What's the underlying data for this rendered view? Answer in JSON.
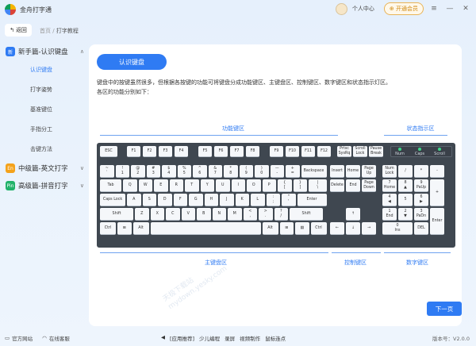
{
  "app": {
    "title": "金舟打字通",
    "user": "个人中心",
    "vip": "开通会员"
  },
  "nav": {
    "back": "返回",
    "crumb_home": "首页",
    "crumb_sep": "/",
    "crumb_current": "打字教程"
  },
  "sidebar": {
    "sections": [
      {
        "badge": "新",
        "badge_color": "#2f7bf3",
        "label": "新手篇-认识键盘",
        "chev": "∧"
      },
      {
        "badge": "En",
        "badge_color": "#f4a21b",
        "label": "中级篇-英文打字",
        "chev": "∨"
      },
      {
        "badge": "Pin",
        "badge_color": "#21b26a",
        "label": "高级篇-拼音打字",
        "chev": "∨"
      }
    ],
    "items": [
      "认识键盘",
      "打字姿势",
      "基准键位",
      "手指分工",
      "击键方法"
    ]
  },
  "content": {
    "heading": "认识键盘",
    "desc1": "键盘中的按键虽然很多，但根据各按键的功能可将键盘分成功能键区、主键盘区、控制键区、数字键区和状态指示灯区。",
    "desc2": "各区的功能分别如下：",
    "labels": {
      "function": "功能键区",
      "status": "状态指示区",
      "main": "主键盘区",
      "control": "控制键区",
      "numeric": "数字键区"
    },
    "next": "下一页"
  },
  "keyboard": {
    "fn_row": [
      "ESC",
      "F1",
      "F2",
      "F3",
      "F4",
      "F5",
      "F6",
      "F7",
      "F8",
      "F9",
      "F10",
      "F11",
      "F12"
    ],
    "sys_keys": [
      "Prtsc\nSysRq",
      "Scroll\nLock",
      "Pause\nBreak"
    ],
    "leds": [
      "Num",
      "Caps",
      "Scroll"
    ],
    "row1": [
      "~\n`",
      "!\n1",
      "@\n2",
      "#\n3",
      "$\n4",
      "%\n5",
      "^\n6",
      "&\n7",
      "*\n8",
      "(\n9",
      ")\n0",
      "—\n-",
      "+\n=",
      "Backspace"
    ],
    "row2": [
      "Tab",
      "Q",
      "W",
      "E",
      "R",
      "T",
      "Y",
      "U",
      "I",
      "O",
      "P",
      "{\n[",
      "}\n]",
      "|\n\\"
    ],
    "row3": [
      "Caps Lock",
      "A",
      "S",
      "D",
      "F",
      "G",
      "H",
      "J",
      "K",
      "L",
      ":\n;",
      "\"\n'",
      "Enter"
    ],
    "row4": [
      "Shift",
      "Z",
      "X",
      "C",
      "V",
      "B",
      "N",
      "M",
      "<\n,",
      ">\n.",
      "?\n/",
      "Shift"
    ],
    "row5": [
      "Ctrl",
      "⊞",
      "Alt",
      "",
      "Alt",
      "⊞",
      "▤",
      "Ctrl"
    ],
    "ctrl_top": [
      "Insert",
      "Home",
      "Page\nUp",
      "Delete",
      "End",
      "Page\nDown"
    ],
    "arrows": [
      "↑",
      "←",
      "↓",
      "→"
    ],
    "num": [
      "Num\nLock",
      "/",
      "*",
      "-",
      "7\nHome",
      "8\n▲",
      "9\nPaUp",
      "+",
      "4\n◀",
      "5",
      "6\n▶",
      "1\nEnd",
      "2\n▼",
      "3\nPaDn",
      "Enter",
      "0\nIns",
      "DEL"
    ]
  },
  "footer": {
    "site": "官方网站",
    "service": "在线客服",
    "rec": "[应用推荐]",
    "apps": [
      "少儿编程",
      "录屏",
      "视频制作",
      "鼠标连点"
    ],
    "version": "版本号：V2.0.0"
  },
  "watermark": [
    "天极下载站",
    "mydown.yesky.com"
  ]
}
